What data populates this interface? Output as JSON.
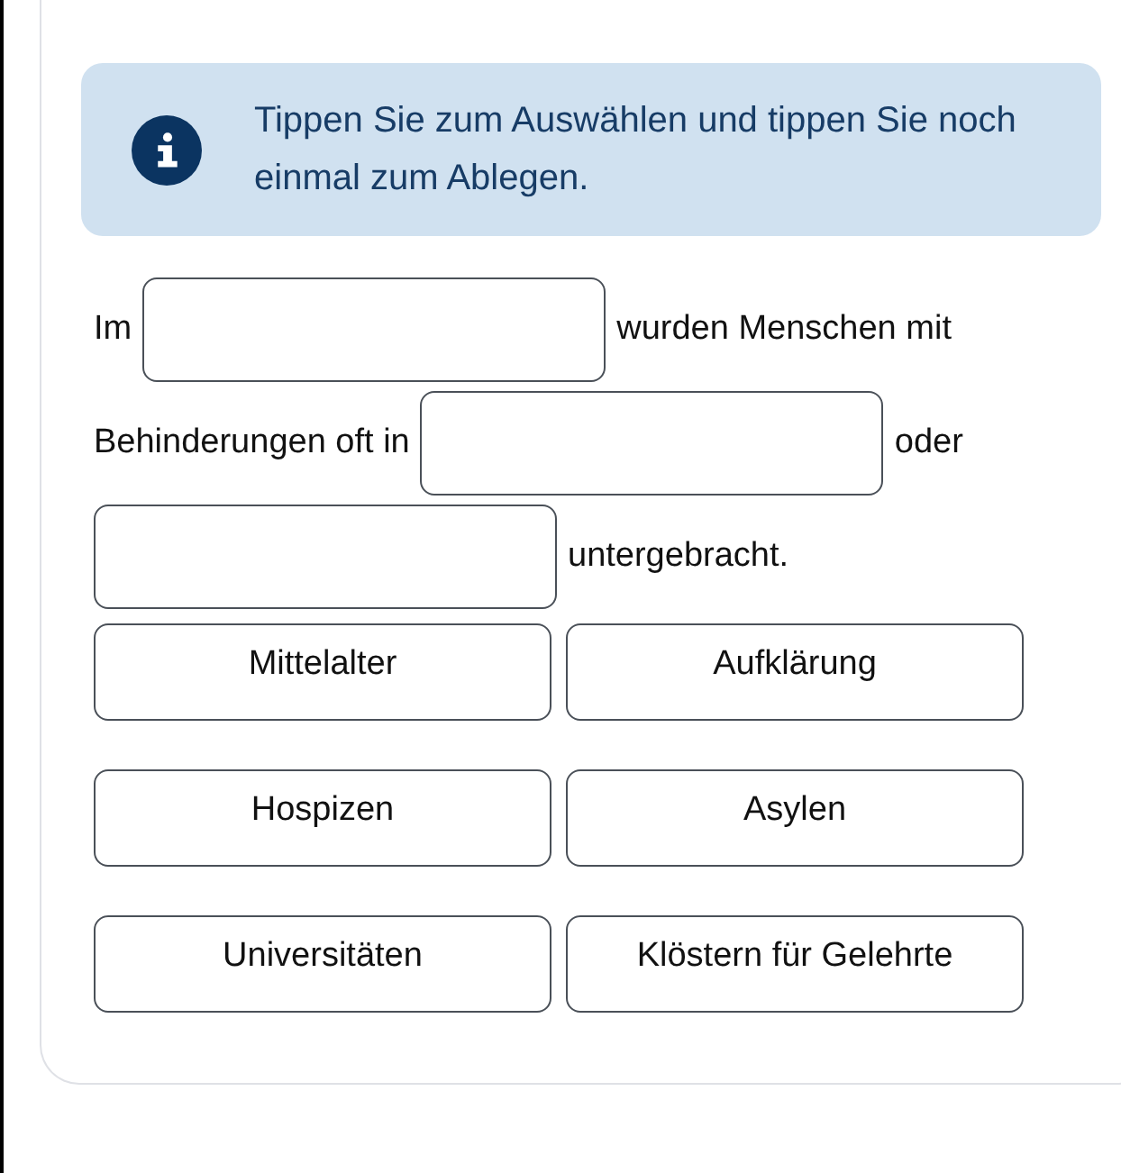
{
  "hint": {
    "text": "Tippen Sie zum Auswählen und tippen Sie noch einmal zum Ablegen."
  },
  "sentence": [
    {
      "kind": "text",
      "text": "Im"
    },
    {
      "kind": "blank"
    },
    {
      "kind": "text",
      "text": "wurden Menschen mit"
    },
    {
      "kind": "text",
      "text": "Behinderungen oft in"
    },
    {
      "kind": "blank"
    },
    {
      "kind": "text",
      "text": "oder"
    },
    {
      "kind": "blank"
    },
    {
      "kind": "text",
      "text": "untergebracht."
    }
  ],
  "options": [
    {
      "label": "Mittelalter"
    },
    {
      "label": "Aufklärung"
    },
    {
      "label": "Hospizen"
    },
    {
      "label": "Asylen"
    },
    {
      "label": "Universitäten"
    },
    {
      "label": "Klöstern für Gelehrte"
    }
  ]
}
